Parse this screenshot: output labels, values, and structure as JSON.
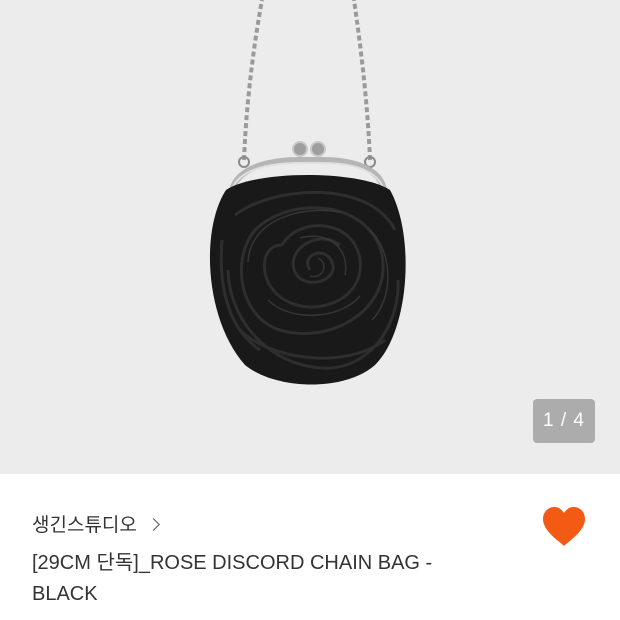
{
  "product_image": {
    "alt": "Black rose chain bag",
    "counter": "1 / 4"
  },
  "product": {
    "brand": "생긴스튜디오",
    "title": "[29CM 단독]_ROSE DISCORD CHAIN BAG - BLACK",
    "liked": true
  },
  "colors": {
    "background": "#ececec",
    "heart": "#f35b14",
    "text": "#333333"
  },
  "icons": {
    "brand_chevron": "chevron-right-icon",
    "like": "heart-icon"
  }
}
